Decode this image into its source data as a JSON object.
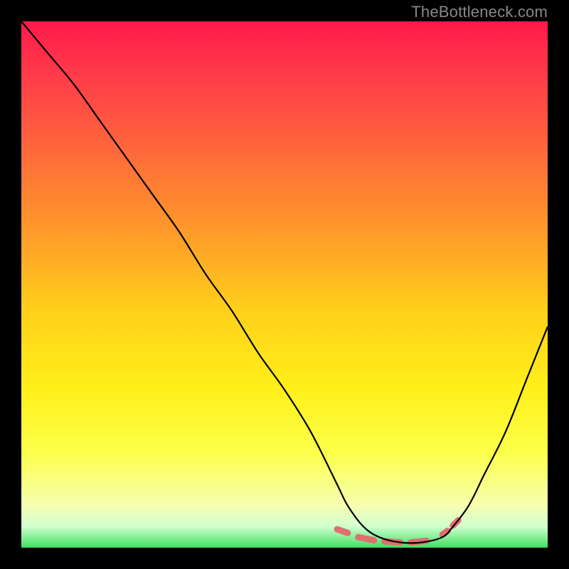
{
  "watermark": "TheBottleneck.com",
  "chart_data": {
    "type": "line",
    "title": "",
    "xlabel": "",
    "ylabel": "",
    "xlim": [
      0,
      100
    ],
    "ylim": [
      0,
      100
    ],
    "grid": false,
    "legend": false,
    "series": [
      {
        "name": "curve",
        "x": [
          0,
          5,
          10,
          15,
          20,
          25,
          30,
          35,
          40,
          45,
          50,
          55,
          60,
          62,
          65,
          68,
          72,
          76,
          80,
          82,
          85,
          88,
          92,
          96,
          100
        ],
        "y": [
          100,
          94,
          88,
          81,
          74,
          67,
          60,
          52,
          45,
          37,
          30,
          22,
          12,
          8,
          4,
          2,
          1,
          1,
          2,
          4,
          8,
          14,
          22,
          32,
          42
        ]
      }
    ],
    "markers": {
      "description": "salmon dashed segments near curve minimum",
      "segments": [
        {
          "x1": 60,
          "y1": 3.5,
          "x2": 62,
          "y2": 2.8
        },
        {
          "x1": 64,
          "y1": 2.0,
          "x2": 67,
          "y2": 1.4
        },
        {
          "x1": 69,
          "y1": 1.2,
          "x2": 72,
          "y2": 1.0
        },
        {
          "x1": 74,
          "y1": 1.0,
          "x2": 77,
          "y2": 1.3
        },
        {
          "x1": 80,
          "y1": 2.5,
          "x2": 81,
          "y2": 3.2
        },
        {
          "x1": 82,
          "y1": 4.2,
          "x2": 83,
          "y2": 5.2
        }
      ]
    }
  }
}
